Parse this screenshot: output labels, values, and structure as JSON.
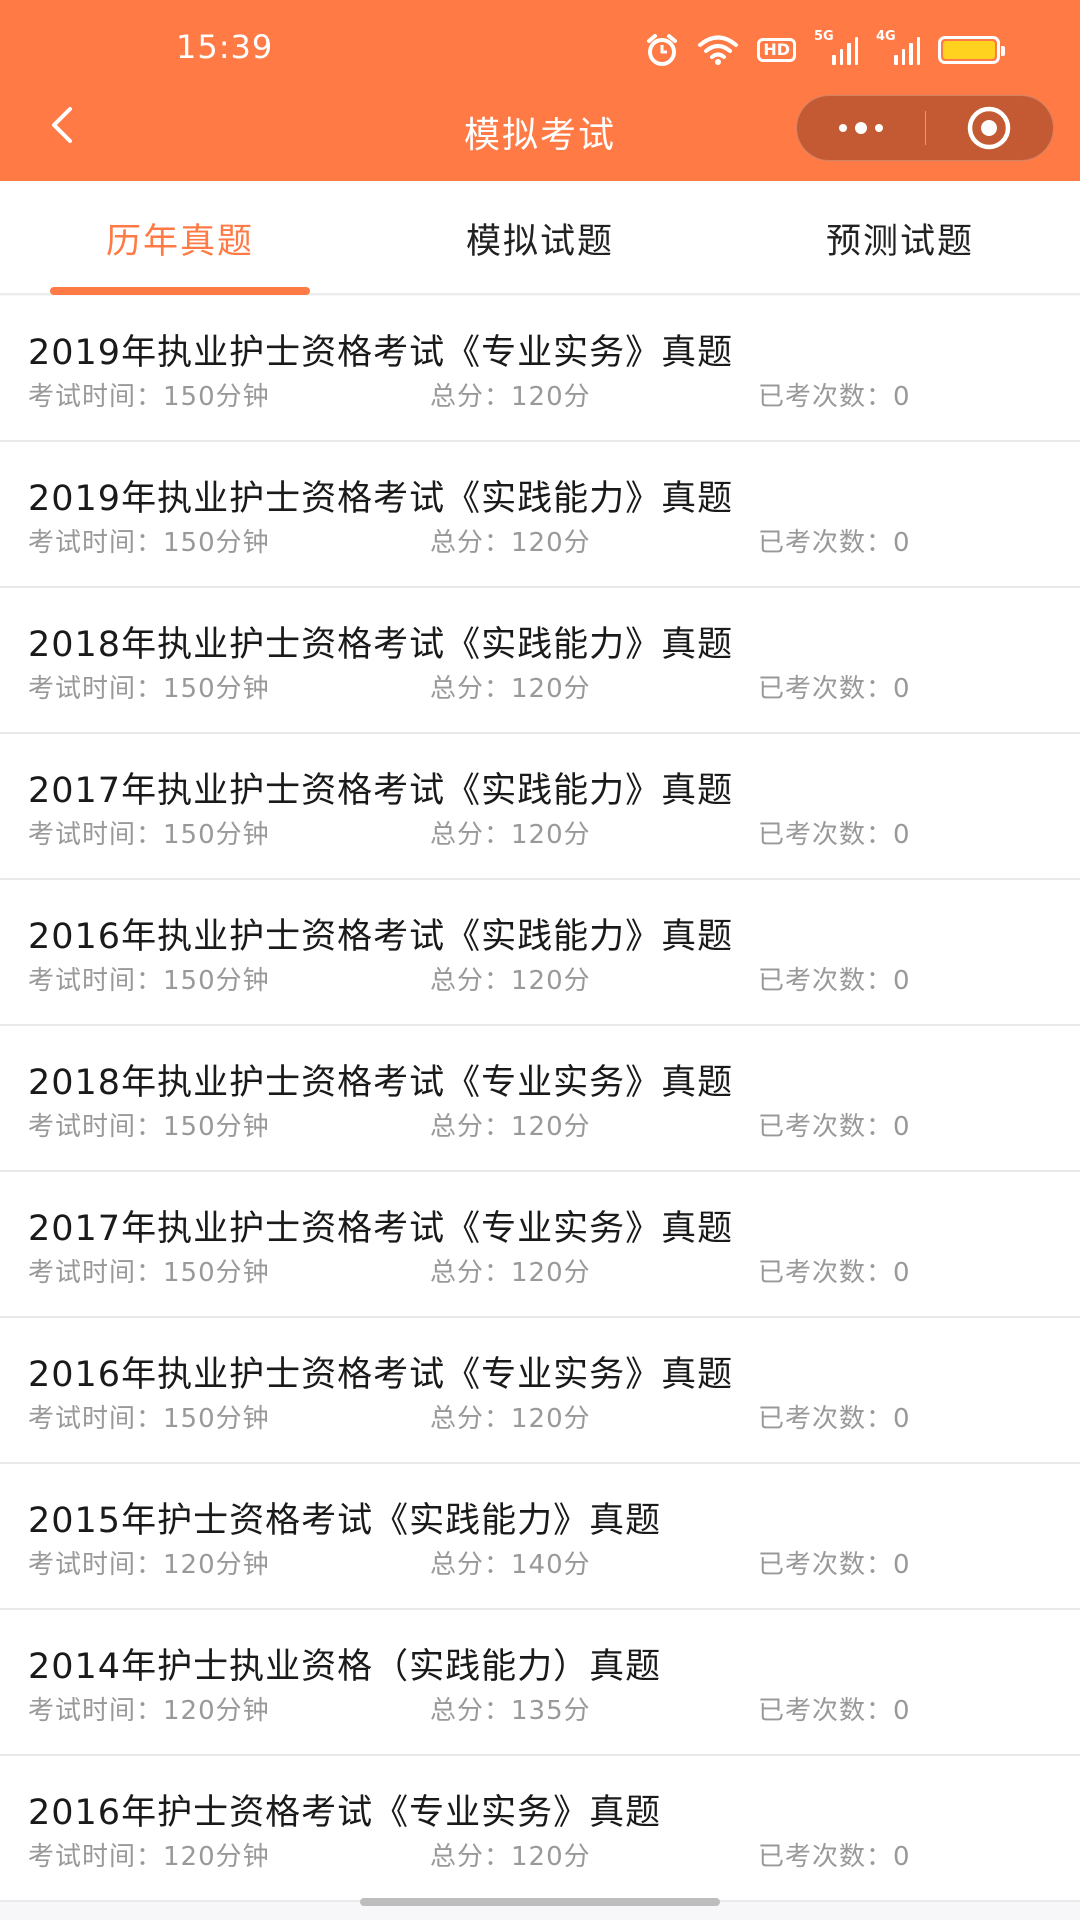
{
  "status_bar": {
    "time": "15:39",
    "hd_label": "HD",
    "net1": "5G",
    "net2": "4G"
  },
  "nav": {
    "title": "模拟考试"
  },
  "tabs": [
    {
      "label": "历年真题",
      "active": true
    },
    {
      "label": "模拟试题",
      "active": false
    },
    {
      "label": "预测试题",
      "active": false
    }
  ],
  "labels": {
    "time": "考试时间：",
    "score": "总分：",
    "count": "已考次数："
  },
  "exams": [
    {
      "title": "2019年执业护士资格考试《专业实务》真题",
      "time": "150分钟",
      "score": "120分",
      "count": "0"
    },
    {
      "title": "2019年执业护士资格考试《实践能力》真题",
      "time": "150分钟",
      "score": "120分",
      "count": "0"
    },
    {
      "title": "2018年执业护士资格考试《实践能力》真题",
      "time": "150分钟",
      "score": "120分",
      "count": "0"
    },
    {
      "title": "2017年执业护士资格考试《实践能力》真题",
      "time": "150分钟",
      "score": "120分",
      "count": "0"
    },
    {
      "title": "2016年执业护士资格考试《实践能力》真题",
      "time": "150分钟",
      "score": "120分",
      "count": "0"
    },
    {
      "title": "2018年执业护士资格考试《专业实务》真题",
      "time": "150分钟",
      "score": "120分",
      "count": "0"
    },
    {
      "title": "2017年执业护士资格考试《专业实务》真题",
      "time": "150分钟",
      "score": "120分",
      "count": "0"
    },
    {
      "title": "2016年执业护士资格考试《专业实务》真题",
      "time": "150分钟",
      "score": "120分",
      "count": "0"
    },
    {
      "title": "2015年护士资格考试《实践能力》真题",
      "time": "120分钟",
      "score": "140分",
      "count": "0"
    },
    {
      "title": "2014年护士执业资格（实践能力）真题",
      "time": "120分钟",
      "score": "135分",
      "count": "0"
    },
    {
      "title": "2016年护士资格考试《专业实务》真题",
      "time": "120分钟",
      "score": "120分",
      "count": "0"
    }
  ],
  "colors": {
    "accent": "#ff7a45",
    "capsule": "#c45a33",
    "battery": "#ffd21f"
  },
  "icons": [
    "alarm-icon",
    "wifi-icon",
    "signal-icon",
    "battery-icon",
    "back-arrow-icon",
    "more-dots-icon",
    "target-icon"
  ]
}
